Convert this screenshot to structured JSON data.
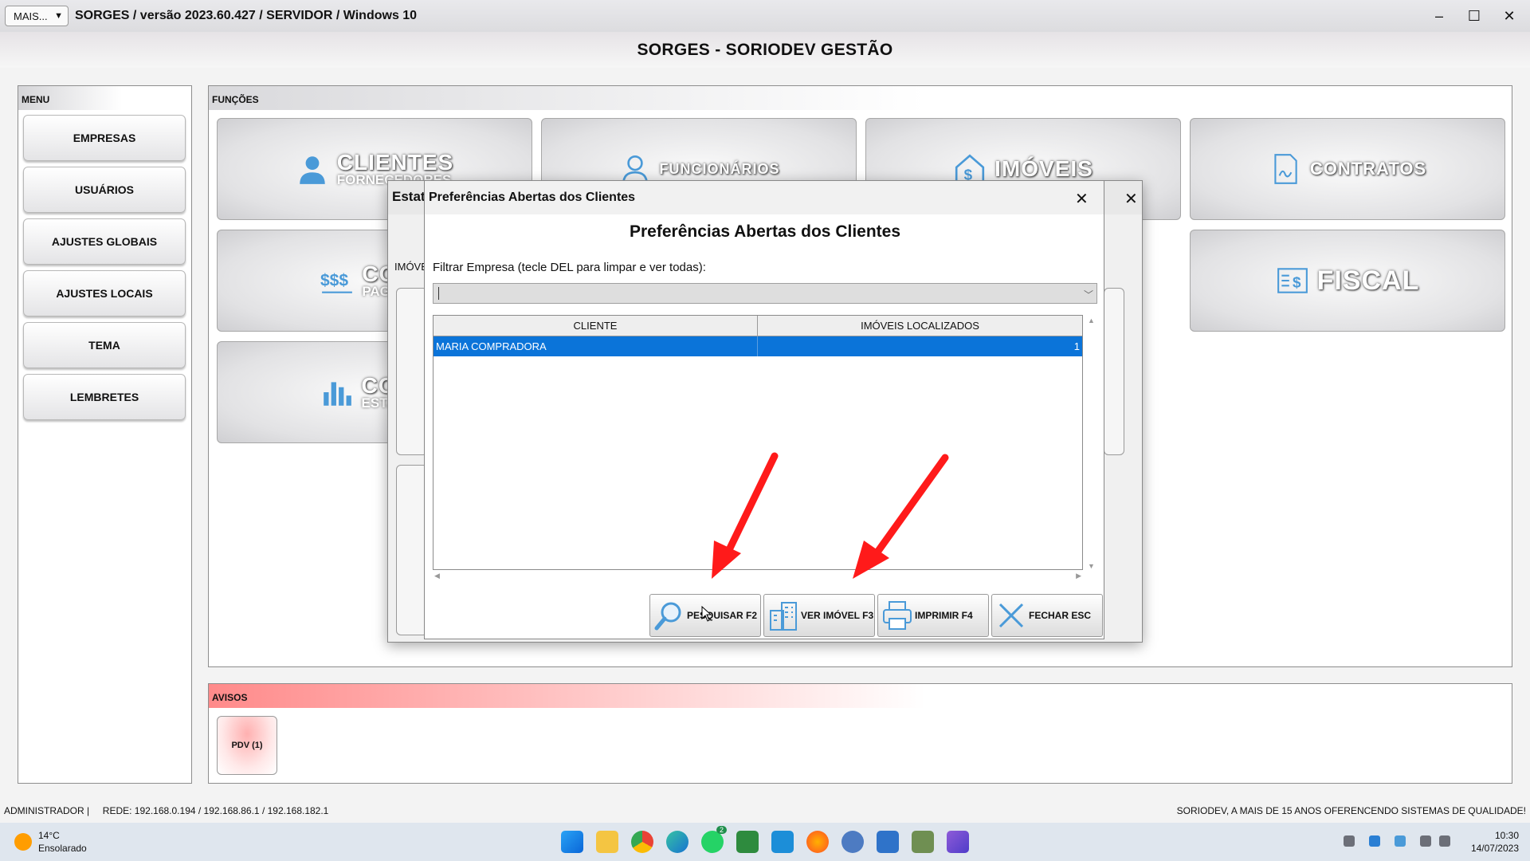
{
  "window": {
    "mais_label": "MAIS...",
    "mais_caret": "▼",
    "title": "SORGES / versão 2023.60.427 / SERVIDOR / Windows 10",
    "minimize": "–",
    "maximize": "☐",
    "close": "✕"
  },
  "app_title": "SORGES - SORIODEV GESTÃO",
  "menu": {
    "heading": "MENU",
    "items": [
      "EMPRESAS",
      "USUÁRIOS",
      "AJUSTES GLOBAIS",
      "AJUSTES LOCAIS",
      "TEMA",
      "LEMBRETES"
    ]
  },
  "funcoes": {
    "heading": "FUNÇÕES",
    "tiles": {
      "clientes": "CLIENTES",
      "clientes_sub": "FORNECEDORES",
      "funcionarios": "FUNCIONÁRIOS",
      "imoveis": "IMÓVEIS",
      "contratos": "CONTRATOS",
      "contas": "CONT",
      "contas_sub": "PAGAM",
      "fiscal": "FISCAL",
      "consultas": "CONS",
      "consultas_sub": "ESTAT"
    }
  },
  "avisos": {
    "heading": "AVISOS",
    "pdv": "PDV (1)"
  },
  "statusbar": {
    "left": "ADMINISTRADOR |     REDE: 192.168.0.194 / 192.168.86.1 / 192.168.182.1",
    "right": "SORIODEV, A MAIS DE 15 ANOS OFERENCENDO SISTEMAS DE QUALIDADE!"
  },
  "outer_dialog": {
    "title": "Estat",
    "close": "✕",
    "tab_label": "IMÓVE"
  },
  "dialog": {
    "title": "Preferências Abertas dos Clientes",
    "close": "✕",
    "heading": "Preferências Abertas dos Clientes",
    "filter_label": "Filtrar Empresa (tecle DEL para limpar e ver todas):",
    "filter_value": "",
    "columns": [
      "CLIENTE",
      "IMÓVEIS LOCALIZADOS"
    ],
    "rows": [
      {
        "cliente": "MARIA COMPRADORA",
        "imoveis": "1"
      }
    ],
    "buttons": {
      "pesquisar": "PESQUISAR F2",
      "ver": "VER IMÓVEL F3",
      "imprimir": "IMPRIMIR F4",
      "fechar": "FECHAR ESC"
    }
  },
  "taskbar": {
    "temp": "14°C",
    "weather": "Ensolarado",
    "time": "10:30",
    "date": "14/07/2023",
    "whatsapp_badge": "2"
  },
  "colors": {
    "selection": "#0b74d9",
    "arrow": "#ff1a1a",
    "icon_blue": "#4a9ad8"
  }
}
